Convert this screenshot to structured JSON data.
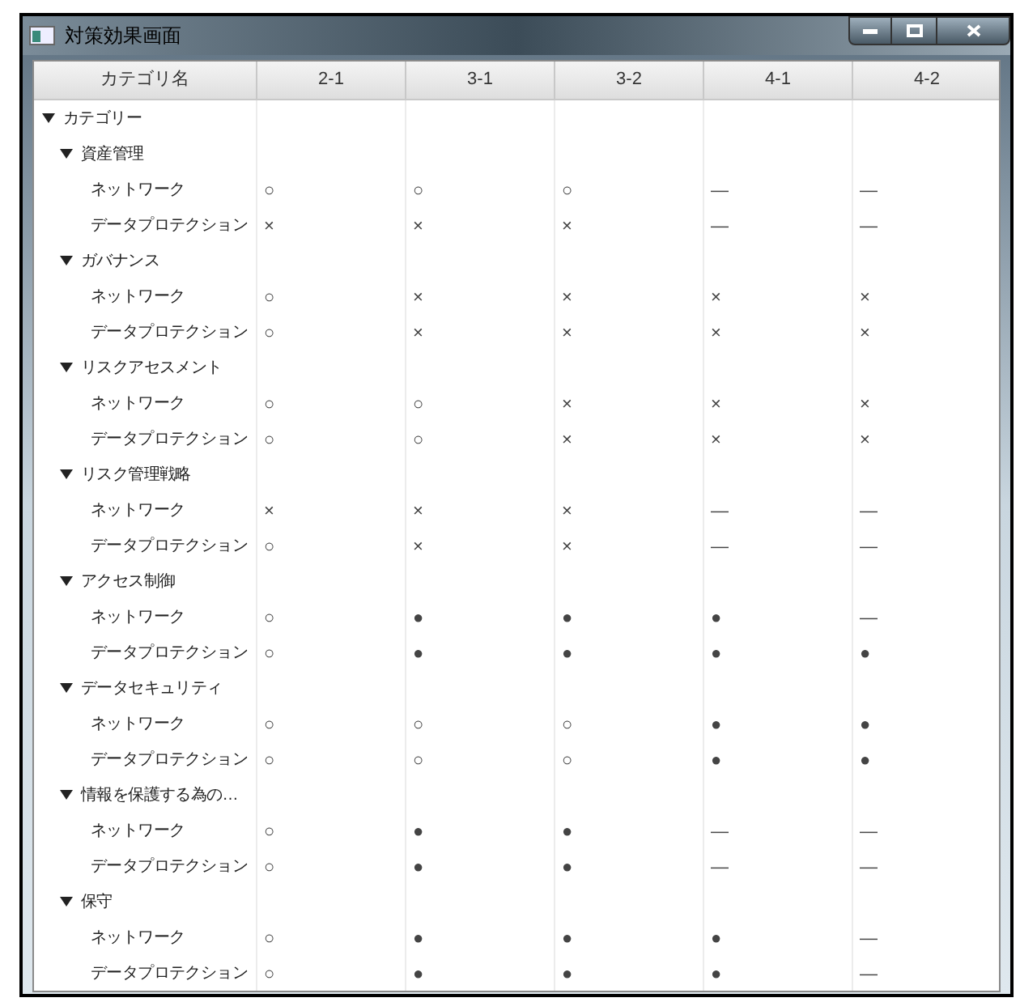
{
  "window": {
    "title": "対策効果画面"
  },
  "table": {
    "columns": [
      "カテゴリ名",
      "2-1",
      "3-1",
      "3-2",
      "4-1",
      "4-2"
    ],
    "tree": {
      "label": "カテゴリー",
      "expanded": true,
      "children": [
        {
          "label": "資産管理",
          "expanded": true,
          "children": [
            {
              "label": "ネットワーク",
              "cells": [
                "○",
                "○",
                "○",
                "—",
                "—"
              ]
            },
            {
              "label": "データプロテクション",
              "cells": [
                "×",
                "×",
                "×",
                "—",
                "—"
              ]
            }
          ]
        },
        {
          "label": "ガバナンス",
          "expanded": true,
          "children": [
            {
              "label": "ネットワーク",
              "cells": [
                "○",
                "×",
                "×",
                "×",
                "×"
              ]
            },
            {
              "label": "データプロテクション",
              "cells": [
                "○",
                "×",
                "×",
                "×",
                "×"
              ]
            }
          ]
        },
        {
          "label": "リスクアセスメント",
          "expanded": true,
          "children": [
            {
              "label": "ネットワーク",
              "cells": [
                "○",
                "○",
                "×",
                "×",
                "×"
              ]
            },
            {
              "label": "データプロテクション",
              "cells": [
                "○",
                "○",
                "×",
                "×",
                "×"
              ]
            }
          ]
        },
        {
          "label": "リスク管理戦略",
          "expanded": true,
          "children": [
            {
              "label": "ネットワーク",
              "cells": [
                "×",
                "×",
                "×",
                "—",
                "—"
              ]
            },
            {
              "label": "データプロテクション",
              "cells": [
                "○",
                "×",
                "×",
                "—",
                "—"
              ]
            }
          ]
        },
        {
          "label": "アクセス制御",
          "expanded": true,
          "children": [
            {
              "label": "ネットワーク",
              "cells": [
                "○",
                "●",
                "●",
                "●",
                "—"
              ]
            },
            {
              "label": "データプロテクション",
              "cells": [
                "○",
                "●",
                "●",
                "●",
                "●"
              ]
            }
          ]
        },
        {
          "label": "データセキュリティ",
          "expanded": true,
          "children": [
            {
              "label": "ネットワーク",
              "cells": [
                "○",
                "○",
                "○",
                "●",
                "●"
              ]
            },
            {
              "label": "データプロテクション",
              "cells": [
                "○",
                "○",
                "○",
                "●",
                "●"
              ]
            }
          ]
        },
        {
          "label": "情報を保護する為の…",
          "expanded": true,
          "children": [
            {
              "label": "ネットワーク",
              "cells": [
                "○",
                "●",
                "●",
                "—",
                "—"
              ]
            },
            {
              "label": "データプロテクション",
              "cells": [
                "○",
                "●",
                "●",
                "—",
                "—"
              ]
            }
          ]
        },
        {
          "label": "保守",
          "expanded": true,
          "children": [
            {
              "label": "ネットワーク",
              "cells": [
                "○",
                "●",
                "●",
                "●",
                "—"
              ]
            },
            {
              "label": "データプロテクション",
              "cells": [
                "○",
                "●",
                "●",
                "●",
                "—"
              ]
            }
          ]
        }
      ]
    }
  }
}
